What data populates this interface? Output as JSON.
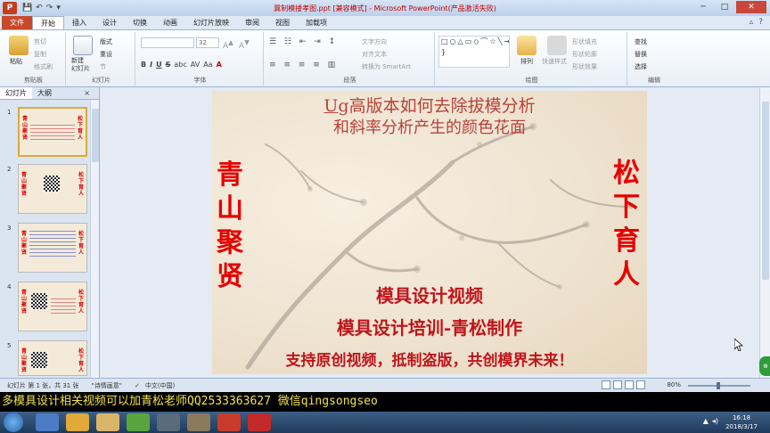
{
  "window": {
    "title": "冀制模搂孝图.ppt [兼容模式] - Microsoft PowerPoint(产品激活失败)",
    "app_icon": "P",
    "qat": [
      "💾",
      "↶",
      "↷",
      "▾"
    ],
    "controls": {
      "minimize": "─",
      "maximize": "□",
      "close": "✕"
    }
  },
  "ribbon_tabs": {
    "file": "文件",
    "items": [
      "开始",
      "插入",
      "设计",
      "切换",
      "动画",
      "幻灯片放映",
      "审阅",
      "视图",
      "加载项"
    ],
    "active": "开始",
    "right_icons": [
      "▵",
      "?"
    ]
  },
  "ribbon": {
    "clipboard": {
      "label": "剪贴板",
      "paste": "粘贴",
      "cut": "剪切",
      "copy": "复制",
      "format_painter": "格式刷"
    },
    "slides": {
      "label": "幻灯片",
      "new_slide": "新建\n幻灯片",
      "layout": "版式",
      "reset": "重设",
      "section": "节"
    },
    "font": {
      "label": "字体",
      "size": "32",
      "bold": "B",
      "italic": "I",
      "underline": "U",
      "strike": "S",
      "shadow": "abc",
      "char_spacing": "AV",
      "case": "Aa",
      "color": "A"
    },
    "paragraph": {
      "label": "段落",
      "text_direction": "文字方向",
      "align_text": "对齐文本",
      "smartart": "转换为 SmartArt"
    },
    "drawing": {
      "label": "绘图",
      "shapes": "□○△▭◇⌒☆╲→↘{ }",
      "arrange": "排列",
      "quick_styles": "快速样式",
      "fill": "形状填充",
      "outline": "形状轮廓",
      "effects": "形状效果"
    },
    "editing": {
      "label": "编辑",
      "find": "查找",
      "replace": "替换",
      "select": "选择"
    }
  },
  "left_panel": {
    "tabs": [
      "幻灯片",
      "大纲"
    ],
    "close": "×",
    "thumbnails": [
      {
        "num": "1",
        "left": "青山聚贤",
        "right": "松下育人"
      },
      {
        "num": "2",
        "left": "青山聚贤",
        "right": "松下育人"
      },
      {
        "num": "3",
        "left": "青山聚贤",
        "right": "松下育人"
      },
      {
        "num": "4",
        "left": "青山聚贤",
        "right": "松下育人"
      },
      {
        "num": "5",
        "left": "青山聚贤",
        "right": "松下育人"
      }
    ]
  },
  "slide": {
    "title_line1_prefix": "Ug",
    "title_line1_rest": "高版本如何去除拔模分析",
    "title_line2": "和斜率分析产生的颜色花面",
    "left_vertical": "青山聚贤",
    "right_vertical": "松下育人",
    "line1": "模具设计视频",
    "line2": "模具设计培训-青松制作",
    "line3": "支持原创视频，抵制盗版，共创模界未来！"
  },
  "statusbar": {
    "slide_info": "幻灯片 第 1 张，共 31 张",
    "theme": "\"诗情画意\"",
    "language": "中文(中国)",
    "zoom": "80%",
    "zoom_level": 0.8
  },
  "overlay_text": "多模具设计相关视频可以加青松老师QQ2533363627  微信qingsongseo",
  "taskbar": {
    "time": "16:18",
    "date": "2018/3/17"
  },
  "colors": {
    "accent_red": "#e60000",
    "slide_text_red": "#c0141b",
    "file_tab": "#c8482a",
    "overlay_text": "#f1e24a"
  }
}
